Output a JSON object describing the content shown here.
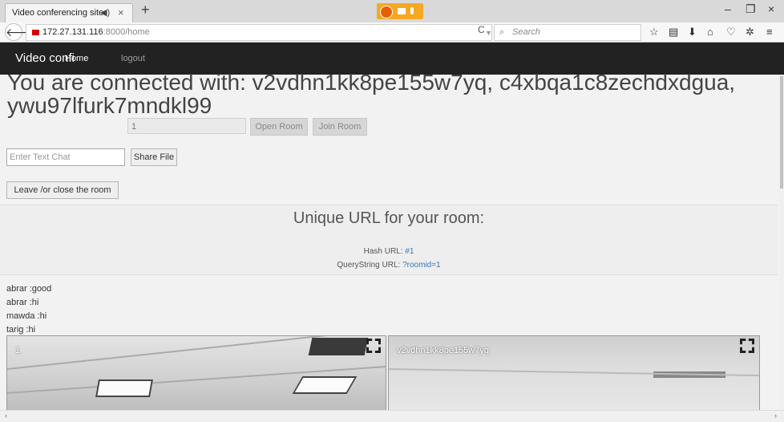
{
  "browser": {
    "tab_title": "Video conferencing site",
    "tab_audio_icon": "speaker-icon",
    "tab_close": "×",
    "new_tab": "+",
    "url_host": "172.27.131.116",
    "url_path": ":8000/home",
    "search_placeholder": "Search",
    "toolbar_icons": [
      "star-icon",
      "reading-list-icon",
      "download-icon",
      "home-icon",
      "pocket-icon",
      "extension-icon",
      "menu-icon"
    ],
    "window_controls": [
      "–",
      "❐",
      "×"
    ]
  },
  "navbar": {
    "brand": "Video confi",
    "home": "Home",
    "logout": "logout"
  },
  "main": {
    "connected_text": "You are connected with: v2vdhn1kk8pe155w7yq, c4xbqa1c8zechdxdgua, ywu97lfurk7mndkl99",
    "room_id_value": "1",
    "open_room_label": "Open Room",
    "join_room_label": "Join Room",
    "chat_placeholder": "Enter Text Chat",
    "share_file_label": "Share File",
    "leave_label": "Leave /or close the room"
  },
  "unique": {
    "title": "Unique URL for your room:",
    "hash_label": "Hash URL:",
    "hash_value": "#1",
    "qs_label": "QueryString URL:",
    "qs_value": "?roomid=1"
  },
  "chat": {
    "messages": [
      "abrar :good",
      "abrar :hi",
      "mawda :hi",
      "tarig :hi"
    ]
  },
  "videos": [
    {
      "label": "1"
    },
    {
      "label": "v2vdhn1kk8pe155w7yq"
    }
  ],
  "colors": {
    "navbar_bg": "#222222",
    "link": "#337ab7",
    "share_indicator": "#f7a721"
  }
}
